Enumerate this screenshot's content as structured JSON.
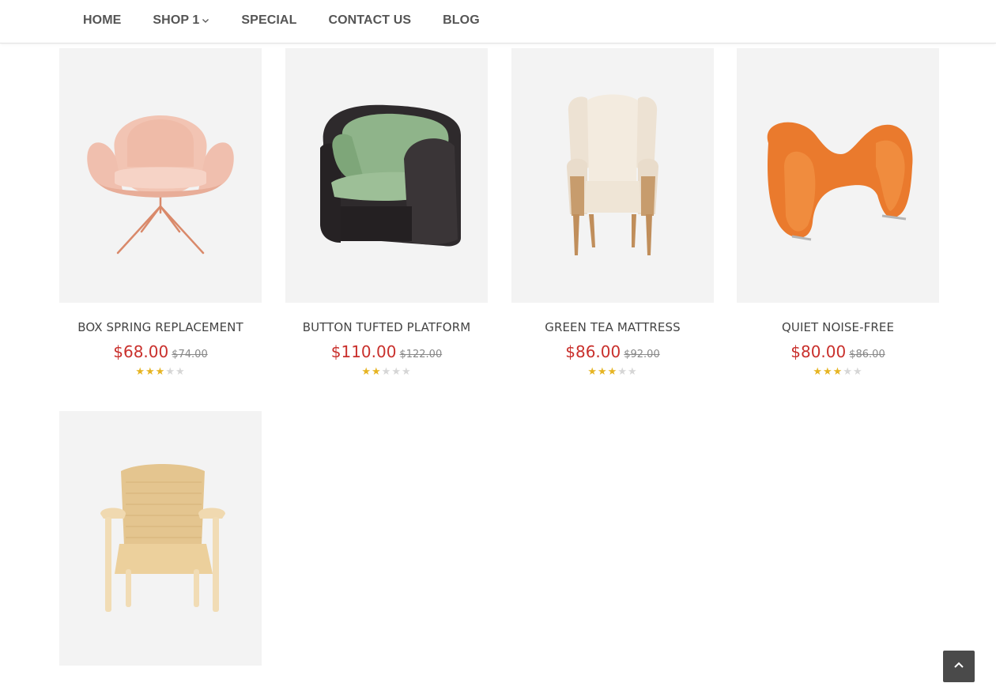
{
  "nav": {
    "items": [
      {
        "label": "HOME"
      },
      {
        "label": "SHOP 1"
      },
      {
        "label": "SPECIAL"
      },
      {
        "label": "CONTACT US"
      },
      {
        "label": "BLOG"
      }
    ]
  },
  "products": [
    {
      "name": "BOX SPRING REPLACEMENT",
      "price": "$68.00",
      "old_price": "$74.00",
      "rating": 3,
      "rating_max": 5,
      "image": "pink-swivel-chair"
    },
    {
      "name": "BUTTON TUFTED PLATFORM",
      "price": "$110.00",
      "old_price": "$122.00",
      "rating": 2,
      "rating_max": 5,
      "image": "green-wicker-armchair"
    },
    {
      "name": "GREEN TEA MATTRESS",
      "price": "$86.00",
      "old_price": "$92.00",
      "rating": 3,
      "rating_max": 5,
      "image": "wingback-chair"
    },
    {
      "name": "QUIET NOISE-FREE",
      "price": "$80.00",
      "old_price": "$86.00",
      "rating": 3,
      "rating_max": 5,
      "image": "orange-lounge-chair"
    },
    {
      "name": "",
      "price": "",
      "old_price": "",
      "rating": 0,
      "rating_max": 5,
      "image": "rope-lounge-chair"
    }
  ],
  "colors": {
    "price": "#c9302c",
    "star": "#e6b422",
    "star_off": "#d6d6d6",
    "thumb_bg": "#f3f3f3"
  },
  "icons": {
    "back_to_top": "chevron-up-icon",
    "dropdown": "chevron-down-icon",
    "star": "star-icon"
  }
}
